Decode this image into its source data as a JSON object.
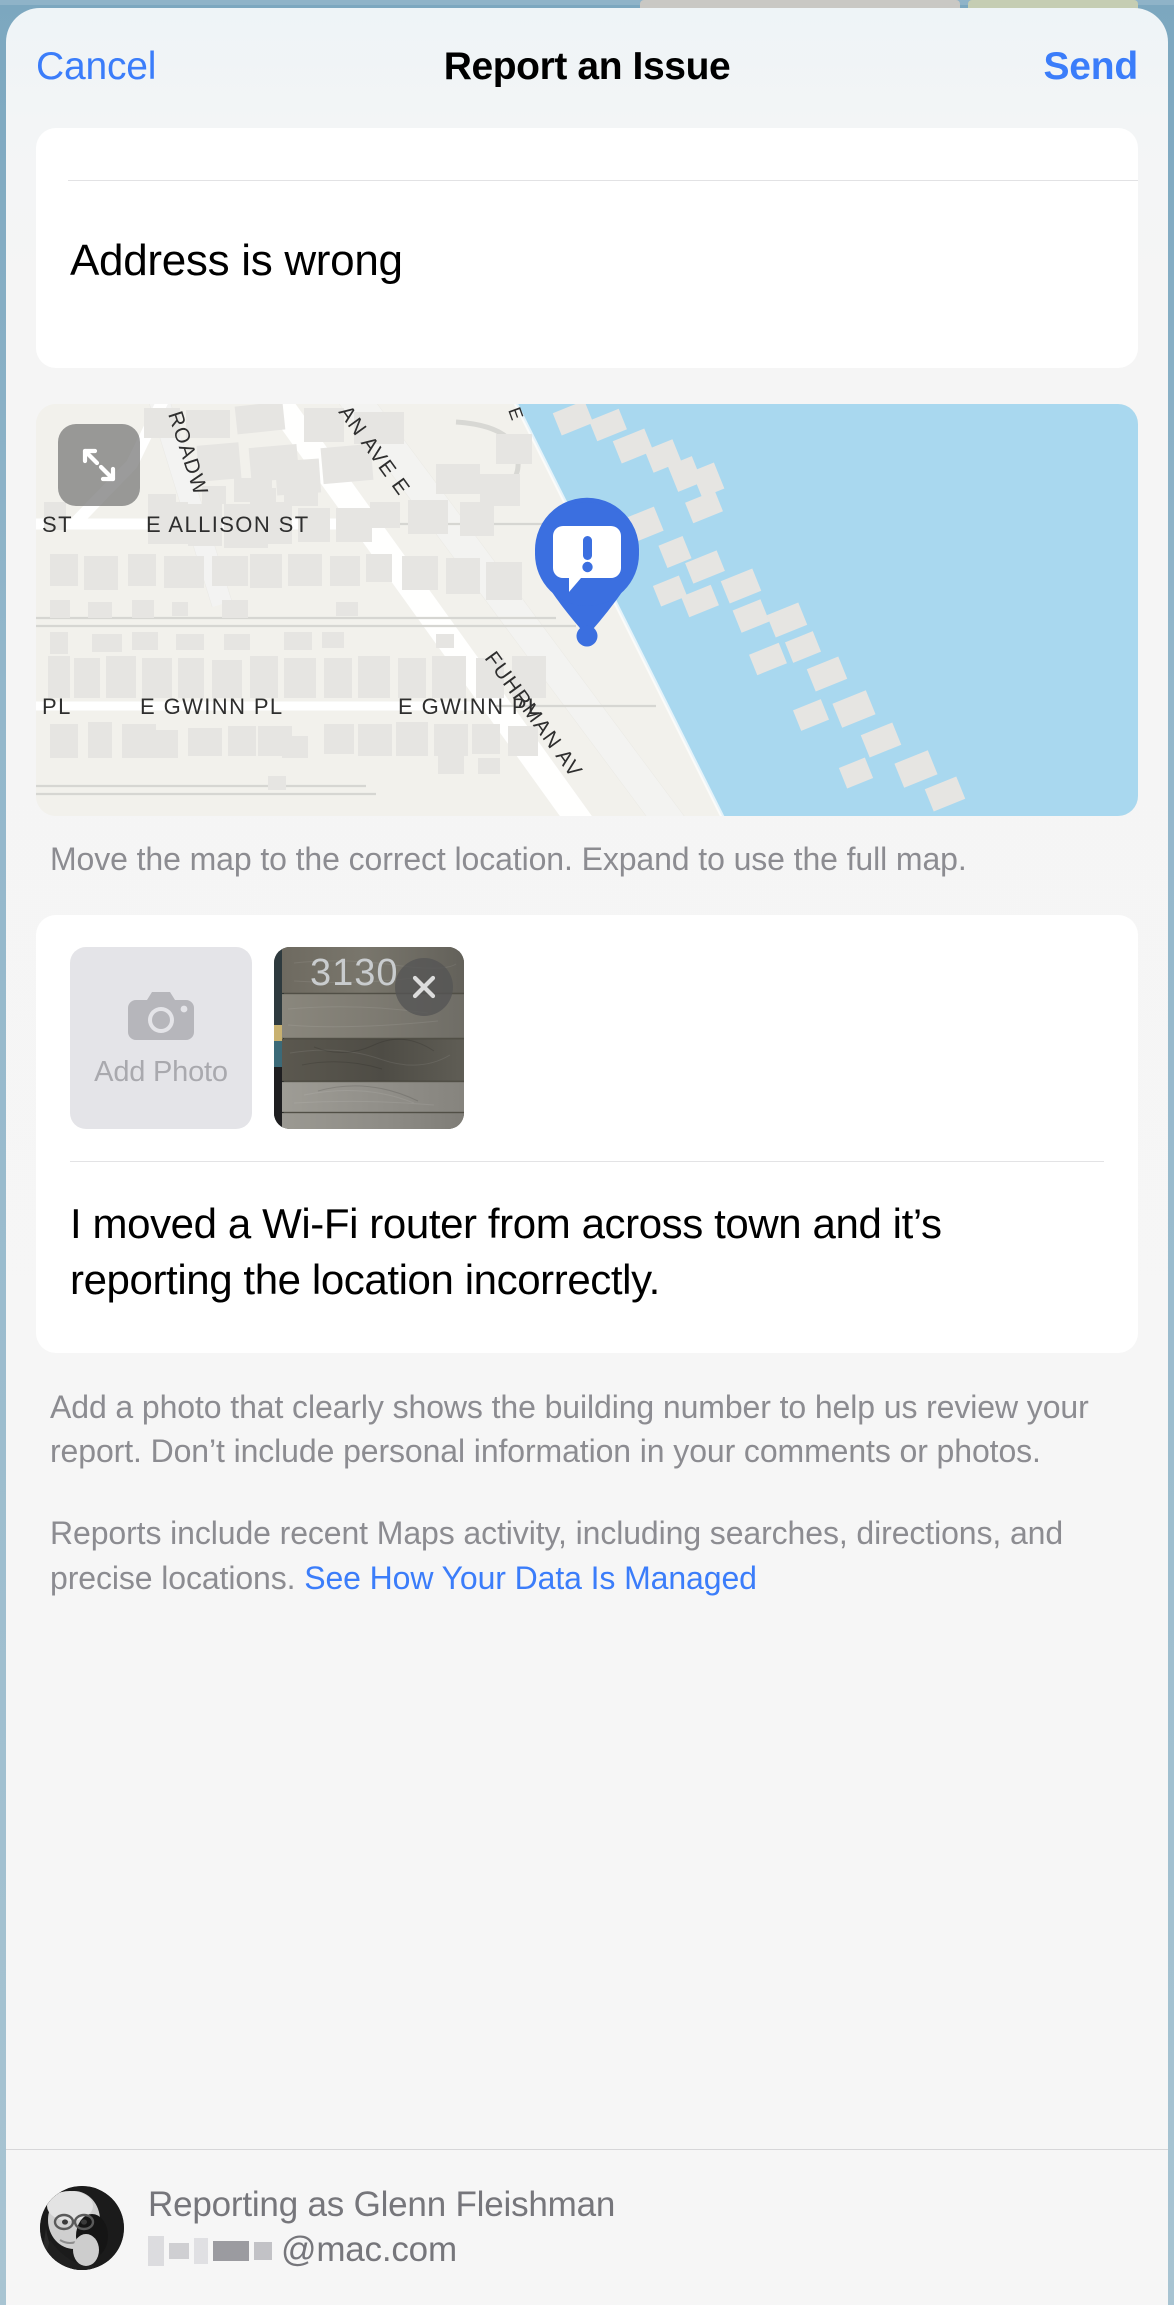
{
  "navbar": {
    "cancel_label": "Cancel",
    "title": "Report an Issue",
    "send_label": "Send"
  },
  "category": {
    "value": "Address is wrong"
  },
  "map": {
    "expand_icon": "expand-arrows-icon",
    "pin_icon": "report-issue-pin-icon",
    "caption": "Move the map to the correct location. Expand to use the full map.",
    "street_labels": [
      "ROADW",
      "AN AVE E",
      "E",
      "ST",
      "E ALLISON ST",
      "PL",
      "E GWINN PL",
      "E GWINN PL",
      "FUHRMAN AV"
    ],
    "colors": {
      "land": "#f2f1ec",
      "water": "#a9d8ef",
      "building": "#e6e5e2",
      "road": "#ffffff",
      "pin": "#3b6fe0"
    }
  },
  "photos": {
    "add_photo_label": "Add Photo",
    "add_photo_icon": "camera-icon",
    "remove_icon": "close-icon",
    "thumbnail_caption": "3130"
  },
  "comment": {
    "text": "I moved a Wi-Fi router from across town and it’s reporting the location incorrectly."
  },
  "footnotes": {
    "photo_note": "Add a photo that clearly shows the building number to help us review your report. Don’t include personal information in your comments or photos.",
    "privacy_note": "Reports include recent Maps activity, including searches, directions, and precise locations. ",
    "privacy_link": "See How Your Data Is Managed"
  },
  "footer": {
    "reporting_as": "Reporting as Glenn Fleishman",
    "email_domain": "@mac.com",
    "avatar_icon": "user-avatar"
  },
  "colors": {
    "accent_blue": "#3b7dfa",
    "sheet_background": "#f6f6f6",
    "secondary_text": "#8c8c91"
  }
}
